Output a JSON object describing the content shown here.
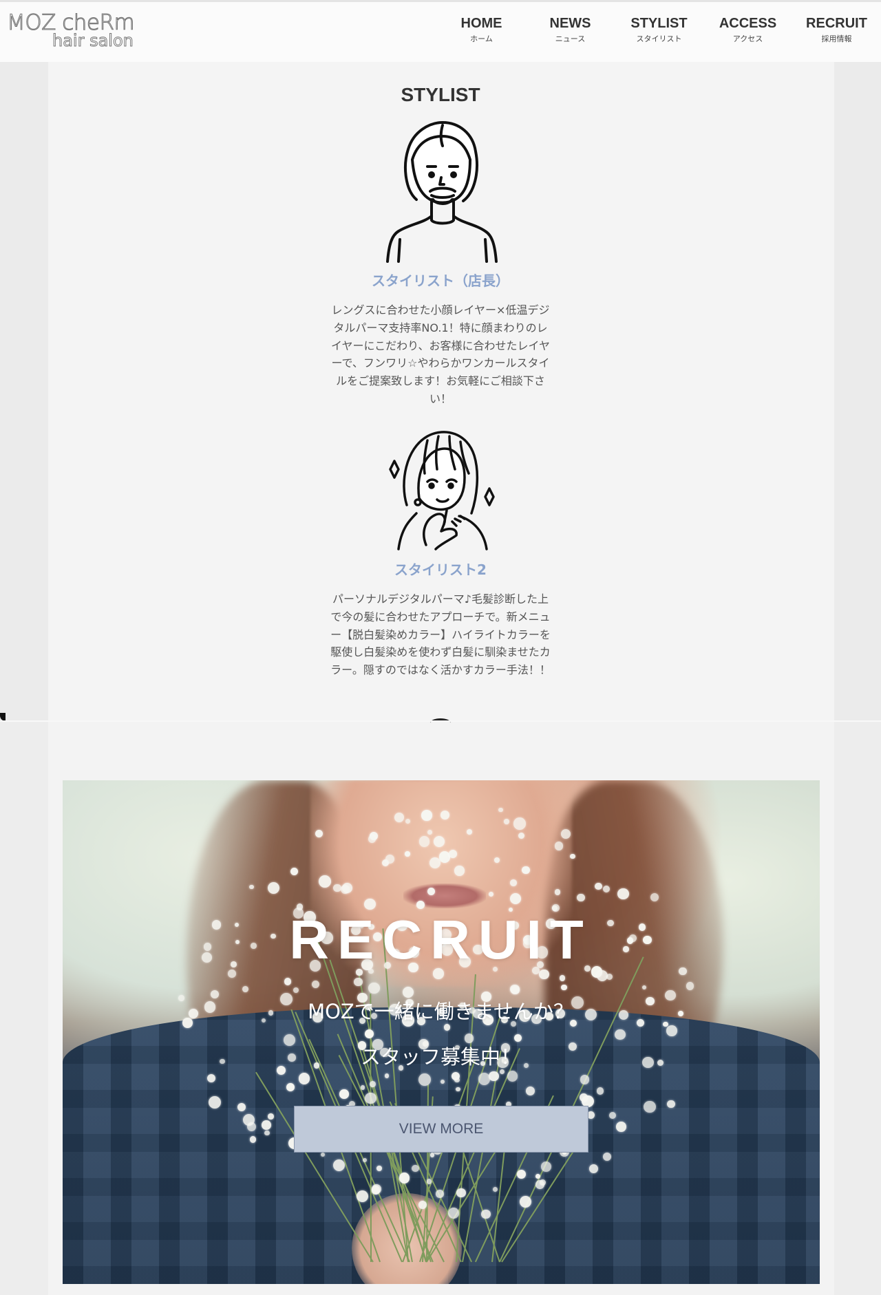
{
  "header": {
    "logo_line1": "MOZ cheRm",
    "logo_line2": "hair salon",
    "nav": [
      {
        "en": "HOME",
        "jp": "ホーム"
      },
      {
        "en": "NEWS",
        "jp": "ニュース"
      },
      {
        "en": "STYLIST",
        "jp": "スタイリスト"
      },
      {
        "en": "ACCESS",
        "jp": "アクセス"
      },
      {
        "en": "RECRUIT",
        "jp": "採用情報"
      }
    ]
  },
  "stylist_section": {
    "title": "STYLIST",
    "stylists": [
      {
        "name": "スタイリスト（店長）",
        "description": "レングスに合わせた小顔レイヤー×低温デジタルパーマ支持率NO.1！特に顔まわりのレイヤーにこだわり、お客様に合わせたレイヤーで、フンワリ☆やわらかワンカールスタイルをご提案致します！お気軽にご相談下さい！",
        "avatar_icon": "male-stylist-illustration-icon"
      },
      {
        "name": "スタイリスト2",
        "description": "パーソナルデジタルパーマ♪毛髪診断した上で今の髪に合わせたアプローチで。新メニュー【脱白髪染めカラー】ハイライトカラーを駆使し白髪染めを使わず白髪に馴染ませたカラー。隠すのではなく活かすカラー手法！！",
        "avatar_icon": "female-stylist-illustration-icon"
      }
    ]
  },
  "recruit_section": {
    "title": "RECRUIT",
    "line1": "MOZで一緒に働きませんか？",
    "line2": "スタッフ募集中！",
    "button_label": "VIEW MORE",
    "button_color": "#bfc9d9"
  },
  "colors": {
    "accent_name": "#8aa3cc",
    "panel": "#f4f4f4",
    "background": "#ebebeb"
  }
}
